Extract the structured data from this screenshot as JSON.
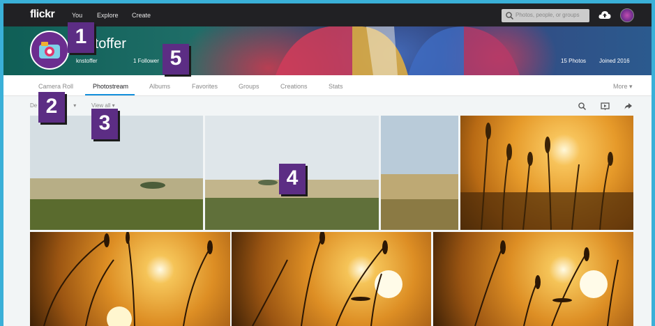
{
  "topnav": {
    "logo": "flickr",
    "links": [
      "You",
      "Explore",
      "Create"
    ],
    "search_placeholder": "Photos, people, or groups"
  },
  "profile": {
    "name": "krstoffer",
    "username": "knstoffer",
    "followers": "1 Follower",
    "following": "ng",
    "photos_count": "15 Photos",
    "joined": "Joined 2016"
  },
  "tabs": [
    "Camera Roll",
    "Photostream",
    "Albums",
    "Favorites",
    "Groups",
    "Creations",
    "Stats"
  ],
  "active_tab": "Photostream",
  "more_label": "More ▾",
  "toolbar": {
    "date_label": "De",
    "date_caret": "▾",
    "view_label": "View all ▾"
  },
  "badges": [
    "1",
    "2",
    "3",
    "4",
    "5"
  ],
  "colors": {
    "topnav_bg": "#212124",
    "accent": "#128fdc",
    "badge": "#5c2d84",
    "outer_border": "#3ab0d8"
  }
}
